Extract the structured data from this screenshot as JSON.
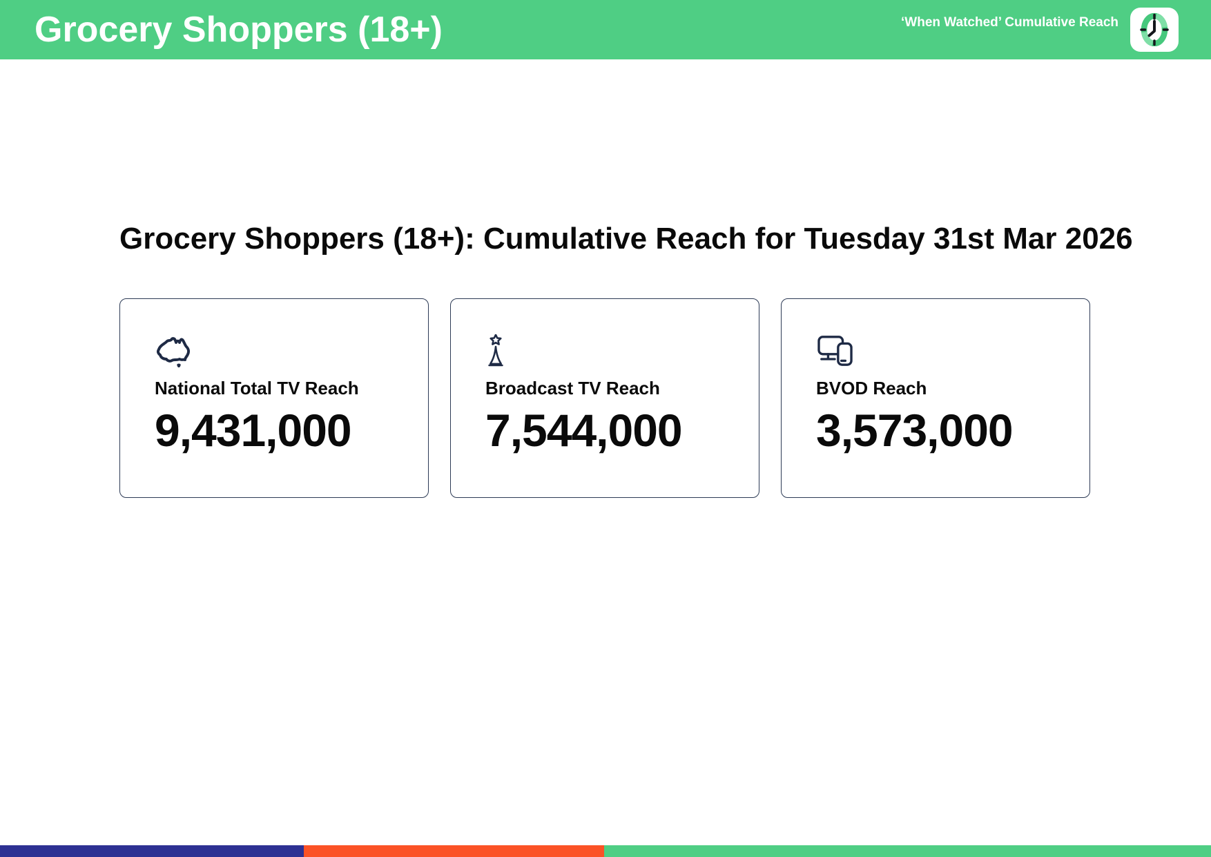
{
  "header": {
    "title": "Grocery Shoppers (18+)",
    "subtitle": "‘When Watched’ Cumulative Reach"
  },
  "main": {
    "heading": "Grocery Shoppers (18+): Cumulative Reach for Tuesday 31st Mar 2026",
    "cards": [
      {
        "icon": "australia-map-icon",
        "label": "National Total TV Reach",
        "value": "9,431,000"
      },
      {
        "icon": "broadcast-tower-icon",
        "label": "Broadcast TV Reach",
        "value": "7,544,000"
      },
      {
        "icon": "tv-and-phone-devices-icon",
        "label": "BVOD Reach",
        "value": "3,573,000"
      }
    ]
  },
  "footer": {
    "segments": [
      {
        "name": "blue",
        "color": "#2d3193",
        "width": "25.1%"
      },
      {
        "name": "orange",
        "color": "#fb5226",
        "width": "24.8%"
      },
      {
        "name": "green",
        "color": "#4fce84",
        "width": "50.1%"
      }
    ]
  },
  "colors": {
    "header_bg": "#4fce84",
    "header_text": "#ffffff",
    "icon_navy": "#1e2a45",
    "card_border": "#2c3a55",
    "text": "#0a0a0a",
    "clock_ring_green": "#46c87d",
    "clock_ring_light": "#7fdfa7"
  }
}
